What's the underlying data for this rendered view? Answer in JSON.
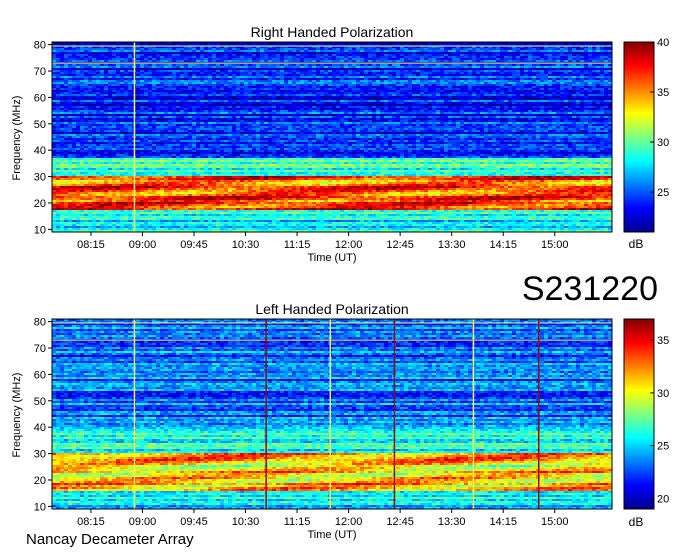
{
  "date_code": "S231220",
  "footer": "Nancay Decameter Array",
  "chart_data": [
    {
      "type": "heatmap",
      "title": "Right Handed Polarization",
      "xlabel": "Time (UT)",
      "ylabel": "Frequency (MHz)",
      "x_ticks": [
        "08:15",
        "09:00",
        "09:45",
        "10:30",
        "11:15",
        "12:00",
        "12:45",
        "13:30",
        "14:15",
        "15:00"
      ],
      "y_ticks": [
        10,
        20,
        30,
        40,
        50,
        60,
        70,
        80
      ],
      "ylim": [
        9,
        81
      ],
      "xlim": [
        "07:41",
        "15:50"
      ],
      "colorbar": {
        "label": "dB",
        "ticks": [
          25,
          30,
          35,
          40
        ],
        "range": [
          21,
          40
        ],
        "colormap": "jet"
      },
      "features": {
        "background_db": 24,
        "band_low_mhz": [
          17,
          30
        ],
        "band_low_db": 36,
        "band_mid_mhz": [
          30,
          37
        ],
        "band_mid_db": 29,
        "vertical_lines_time": [
          "08:53"
        ],
        "horizontal_lines_mhz": [
          73,
          79.5
        ]
      }
    },
    {
      "type": "heatmap",
      "title": "Left Handed Polarization",
      "xlabel": "Time (UT)",
      "ylabel": "Frequency (MHz)",
      "x_ticks": [
        "08:15",
        "09:00",
        "09:45",
        "10:30",
        "11:15",
        "12:00",
        "12:45",
        "13:30",
        "14:15",
        "15:00"
      ],
      "y_ticks": [
        10,
        20,
        30,
        40,
        50,
        60,
        70,
        80
      ],
      "ylim": [
        9,
        81
      ],
      "xlim": [
        "07:41",
        "15:50"
      ],
      "colorbar": {
        "label": "dB",
        "ticks": [
          20,
          25,
          30,
          35
        ],
        "range": [
          19,
          37
        ],
        "colormap": "jet"
      },
      "features": {
        "background_db": 23,
        "band_low_mhz": [
          16,
          30
        ],
        "band_low_db": 31,
        "band_mid_mhz": [
          30,
          40
        ],
        "band_mid_db": 26,
        "vertical_lines_time": [
          "08:53",
          "10:48",
          "11:44",
          "12:40",
          "13:49",
          "14:46"
        ],
        "horizontal_lines_mhz": [
          73,
          79.5
        ]
      }
    }
  ]
}
